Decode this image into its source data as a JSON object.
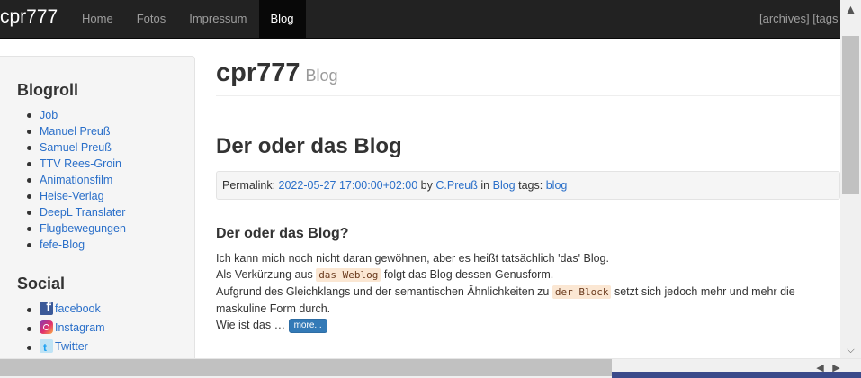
{
  "navbar": {
    "brand": "cpr777",
    "items": [
      {
        "label": "Home"
      },
      {
        "label": "Fotos"
      },
      {
        "label": "Impressum"
      },
      {
        "label": "Blog",
        "active": true
      }
    ],
    "right_archives": "[archives]",
    "right_tags": "[tags"
  },
  "sidebar": {
    "blogroll_title": "Blogroll",
    "blogroll": [
      "Job",
      "Manuel Preuß",
      "Samuel Preuß",
      "TTV Rees-Groin",
      "Animationsfilm",
      "Heise-Verlag",
      "DeepL Translater",
      "Flugbewegungen",
      "fefe-Blog"
    ],
    "social_title": "Social",
    "social": [
      {
        "label": "facebook",
        "icon": "facebook-icon"
      },
      {
        "label": "Instagram",
        "icon": "instagram-icon"
      },
      {
        "label": "Twitter",
        "icon": "twitter-icon"
      }
    ]
  },
  "main": {
    "site_title": "cpr777",
    "site_subtitle": "Blog",
    "post_title": "Der oder das Blog",
    "permalink": {
      "label": "Permalink:",
      "date": "2022-05-27 17:00:00+02:00",
      "by_label": "by",
      "author": "C.Preuß",
      "in_label": "in",
      "category": "Blog",
      "tags_label": "tags:",
      "tag": "blog"
    },
    "sub_title": "Der oder das Blog?",
    "para1": "Ich kann mich noch nicht daran gewöhnen, aber es heißt tatsächlich 'das' Blog.",
    "para2_pre": "Als Verkürzung aus",
    "para2_code": "das Weblog",
    "para2_post": "folgt das Blog dessen Genusform.",
    "para3_pre": "Aufgrund des Gleichklangs und der semantischen Ähnlichkeiten zu",
    "para3_code": "der Block",
    "para3_post": "setzt sich jedoch mehr und mehr die maskuline Form durch.",
    "para4": "Wie ist das …",
    "more_label": "more..."
  },
  "scrollbar": {
    "up_arrow": "▲",
    "down_arrow": "⌵",
    "left_arrow": "◀",
    "right_arrow": "▶"
  },
  "colors": {
    "navbar": "#222222",
    "link": "#2a6fc9",
    "code_bg": "#fbe7d3",
    "button": "#337ab7"
  }
}
